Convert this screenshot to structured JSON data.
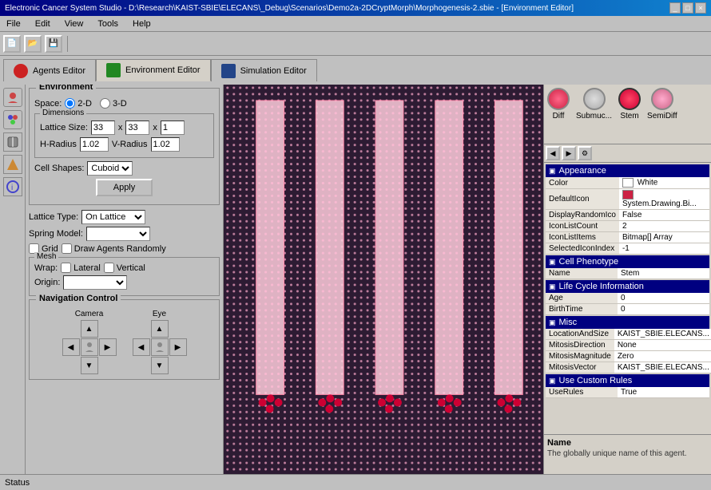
{
  "titleBar": {
    "title": "Electronic Cancer System Studio - D:\\Research\\KAIST-SBIE\\ELECANS\\_Debug\\Scenarios\\Demo2a-2DCryptMorph\\Morphogenesis-2.sbie - [Environment Editor]",
    "buttons": [
      "_",
      "□",
      "×"
    ]
  },
  "menuBar": {
    "items": [
      "File",
      "Edit",
      "View",
      "Tools",
      "Help"
    ]
  },
  "tabs": [
    {
      "id": "agents",
      "label": "Agents Editor",
      "iconType": "agents"
    },
    {
      "id": "environment",
      "label": "Environment Editor",
      "iconType": "env",
      "active": true
    },
    {
      "id": "simulation",
      "label": "Simulation Editor",
      "iconType": "sim"
    }
  ],
  "leftPanel": {
    "environment": {
      "groupTitle": "Environment",
      "spaceLabel": "Space:",
      "space2D": "2-D",
      "space3D": "3-D",
      "dimensionsTitle": "Dimensions",
      "latticeSizeLabel": "Lattice Size:",
      "latticeSizeX": "33",
      "latticeSizeY": "33",
      "latticeSizeZ": "1",
      "hRadiusLabel": "H-Radius",
      "hRadiusValue": "1.02",
      "vRadiusLabel": "V-Radius",
      "vRadiusValue": "1.02",
      "cellShapesLabel": "Cell Shapes:",
      "cellShapesValue": "Cuboid",
      "applyLabel": "Apply"
    },
    "latticeType": {
      "label": "Lattice Type:",
      "value": "On Lattice"
    },
    "springModel": {
      "label": "Spring Model:"
    },
    "checkboxes": {
      "grid": "Grid",
      "drawAgentsRandomly": "Draw Agents Randomly"
    },
    "mesh": {
      "title": "Mesh",
      "wrapLabel": "Wrap:",
      "lateral": "Lateral",
      "vertical": "Vertical",
      "originLabel": "Origin:"
    },
    "navControl": {
      "title": "Navigation Control",
      "cameraLabel": "Camera",
      "eyeLabel": "Eye"
    }
  },
  "rightPanel": {
    "agents": [
      {
        "id": "diff",
        "label": "Diff",
        "iconType": "diff"
      },
      {
        "id": "submc",
        "label": "Submuc...",
        "iconType": "submc"
      },
      {
        "id": "stem",
        "label": "Stem",
        "iconType": "stem"
      },
      {
        "id": "semidiff",
        "label": "SemiDiff",
        "iconType": "semidiff"
      }
    ],
    "properties": {
      "appearance": {
        "title": "Appearance",
        "rows": [
          {
            "name": "Color",
            "value": "White",
            "hasColorSwatch": true
          },
          {
            "name": "DefaultIcon",
            "value": "System.Drawing.Bi...",
            "hasIconSwatch": true
          },
          {
            "name": "DisplayRandomIco",
            "value": "False"
          },
          {
            "name": "IconListCount",
            "value": "2"
          },
          {
            "name": "IconListItems",
            "value": "Bitmap[] Array"
          },
          {
            "name": "SelectedIconIndex",
            "value": "-1"
          }
        ]
      },
      "cellPhenotype": {
        "title": "Cell Phenotype",
        "rows": [
          {
            "name": "Name",
            "value": "Stem"
          }
        ]
      },
      "lifeCycleInfo": {
        "title": "Life Cycle Information",
        "rows": [
          {
            "name": "Age",
            "value": "0"
          },
          {
            "name": "BirthTime",
            "value": "0"
          }
        ]
      },
      "misc": {
        "title": "Misc",
        "rows": [
          {
            "name": "LocationAndSize",
            "value": "KAIST_SBIE.ELECANS..."
          },
          {
            "name": "MitosisDirection",
            "value": "None"
          },
          {
            "name": "MitosisMagnitude",
            "value": "Zero"
          },
          {
            "name": "MitosisVector",
            "value": "KAIST_SBIE.ELECANS..."
          }
        ]
      },
      "useCustomRules": {
        "title": "Use Custom Rules",
        "rows": [
          {
            "name": "UseRules",
            "value": "True"
          }
        ]
      }
    },
    "bottomInfo": {
      "title": "Name",
      "text": "The globally unique name of this agent."
    }
  },
  "statusBar": {
    "text": "Status"
  }
}
